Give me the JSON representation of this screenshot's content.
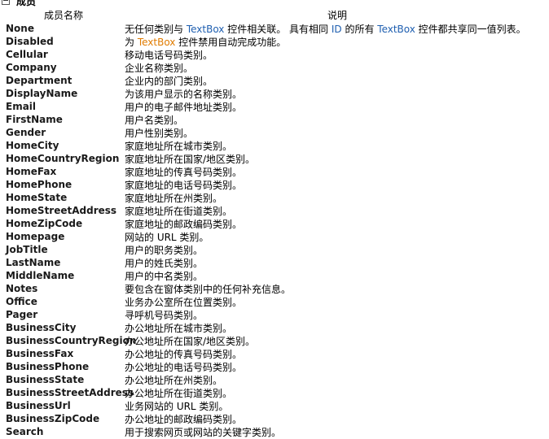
{
  "section": {
    "title": "成员"
  },
  "table": {
    "headers": {
      "name": "成员名称",
      "desc": "说明"
    },
    "rows": [
      {
        "name": "None",
        "desc_parts": [
          {
            "text": "无任何类别与 ",
            "style": "plain"
          },
          {
            "text": "TextBox",
            "style": "blue"
          },
          {
            "text": " 控件相关联。 具有相同 ",
            "style": "plain"
          },
          {
            "text": "ID",
            "style": "blue"
          },
          {
            "text": " 的所有 ",
            "style": "plain"
          },
          {
            "text": "TextBox",
            "style": "blue"
          },
          {
            "text": " 控件都共享同一值列表。",
            "style": "plain"
          }
        ]
      },
      {
        "name": "Disabled",
        "desc_parts": [
          {
            "text": "为 ",
            "style": "plain"
          },
          {
            "text": "TextBox",
            "style": "orange"
          },
          {
            "text": " 控件禁用自动完成功能。",
            "style": "plain"
          }
        ]
      },
      {
        "name": "Cellular",
        "desc": "移动电话号码类别。"
      },
      {
        "name": "Company",
        "desc": "企业名称类别。"
      },
      {
        "name": "Department",
        "desc": "企业内的部门类别。"
      },
      {
        "name": "DisplayName",
        "desc": "为该用户显示的名称类别。"
      },
      {
        "name": "Email",
        "desc": "用户的电子邮件地址类别。"
      },
      {
        "name": "FirstName",
        "desc": "用户名类别。"
      },
      {
        "name": "Gender",
        "desc": "用户性别类别。"
      },
      {
        "name": "HomeCity",
        "desc": "家庭地址所在城市类别。"
      },
      {
        "name": "HomeCountryRegion",
        "desc": "家庭地址所在国家/地区类别。"
      },
      {
        "name": "HomeFax",
        "desc": "家庭地址的传真号码类别。"
      },
      {
        "name": "HomePhone",
        "desc": "家庭地址的电话号码类别。"
      },
      {
        "name": "HomeState",
        "desc": "家庭地址所在州类别。"
      },
      {
        "name": "HomeStreetAddress",
        "desc": "家庭地址所在街道类别。"
      },
      {
        "name": "HomeZipCode",
        "desc": "家庭地址的邮政编码类别。"
      },
      {
        "name": "Homepage",
        "desc": "网站的 URL 类别。"
      },
      {
        "name": "JobTitle",
        "desc": "用户的职务类别。"
      },
      {
        "name": "LastName",
        "desc": "用户的姓氏类别。"
      },
      {
        "name": "MiddleName",
        "desc": "用户的中名类别。"
      },
      {
        "name": "Notes",
        "desc": "要包含在窗体类别中的任何补充信息。"
      },
      {
        "name": "Office",
        "desc": "业务办公室所在位置类别。"
      },
      {
        "name": "Pager",
        "desc": "寻呼机号码类别。"
      },
      {
        "name": "BusinessCity",
        "desc": "办公地址所在城市类别。"
      },
      {
        "name": "BusinessCountryRegion",
        "desc": "办公地址所在国家/地区类别。"
      },
      {
        "name": "BusinessFax",
        "desc": "办公地址的传真号码类别。"
      },
      {
        "name": "BusinessPhone",
        "desc": "办公地址的电话号码类别。"
      },
      {
        "name": "BusinessState",
        "desc": "办公地址所在州类别。"
      },
      {
        "name": "BusinessStreetAddress",
        "desc": "办公地址所在街道类别。"
      },
      {
        "name": "BusinessUrl",
        "desc": "业务网站的 URL 类别。"
      },
      {
        "name": "BusinessZipCode",
        "desc": "办公地址的邮政编码类别。"
      },
      {
        "name": "Search",
        "desc": "用于搜索网页或网站的关键字类别。"
      }
    ]
  }
}
